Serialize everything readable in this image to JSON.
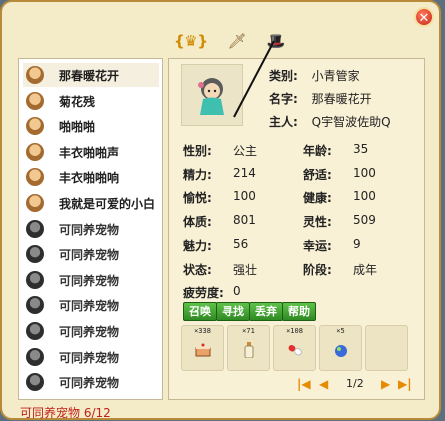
{
  "tabs": [
    "crown-icon",
    "sword-icon",
    "hat-icon"
  ],
  "pets": [
    {
      "name": "那春暖花开",
      "selected": true,
      "empty": false
    },
    {
      "name": "菊花残",
      "selected": false,
      "empty": false
    },
    {
      "name": "啪啪啪",
      "selected": false,
      "empty": false
    },
    {
      "name": "丰衣啪啪声",
      "selected": false,
      "empty": false
    },
    {
      "name": "丰衣啪啪响",
      "selected": false,
      "empty": false
    },
    {
      "name": "我就是可爱的小白",
      "selected": false,
      "empty": false
    },
    {
      "name": "可同养宠物",
      "selected": false,
      "empty": true
    },
    {
      "name": "可同养宠物",
      "selected": false,
      "empty": true
    },
    {
      "name": "可同养宠物",
      "selected": false,
      "empty": true
    },
    {
      "name": "可同养宠物",
      "selected": false,
      "empty": true
    },
    {
      "name": "可同养宠物",
      "selected": false,
      "empty": true
    },
    {
      "name": "可同养宠物",
      "selected": false,
      "empty": true
    },
    {
      "name": "可同养宠物",
      "selected": false,
      "empty": true
    }
  ],
  "footer": {
    "count_text": "可同养宠物 6/12"
  },
  "info": {
    "category_label": "类别:",
    "category_value": "小青管家",
    "name_label": "名字:",
    "name_value": "那春暖花开",
    "owner_label": "主人:",
    "owner_value": "Q宇智波佐助Q"
  },
  "stats": [
    {
      "label": "性别:",
      "value": "公主"
    },
    {
      "label": "年龄:",
      "value": "35"
    },
    {
      "label": "精力:",
      "value": "214"
    },
    {
      "label": "舒适:",
      "value": "100"
    },
    {
      "label": "愉悦:",
      "value": "100"
    },
    {
      "label": "健康:",
      "value": "100"
    },
    {
      "label": "体质:",
      "value": "801"
    },
    {
      "label": "灵性:",
      "value": "509"
    },
    {
      "label": "魅力:",
      "value": "56"
    },
    {
      "label": "幸运:",
      "value": "9"
    },
    {
      "label": "状态:",
      "value": "强壮"
    },
    {
      "label": "阶段:",
      "value": "成年"
    },
    {
      "label": "疲劳度:",
      "value": "0"
    }
  ],
  "buttons": [
    "召唤",
    "寻找",
    "丢弃",
    "帮助"
  ],
  "items": [
    {
      "qty": "×338",
      "icon": "cake-icon"
    },
    {
      "qty": "×71",
      "icon": "bottle-icon"
    },
    {
      "qty": "×108",
      "icon": "capsule-icon"
    },
    {
      "qty": "×5",
      "icon": "potion-icon"
    },
    {
      "qty": "",
      "icon": ""
    }
  ],
  "pager": {
    "first": "|◀",
    "prev": "◀",
    "indicator": "1/2",
    "next": "▶",
    "last": "▶|"
  },
  "colors": {
    "accent_green": "#2f8a22",
    "pager_orange": "#e68a00",
    "warning_red": "#c0201a"
  }
}
